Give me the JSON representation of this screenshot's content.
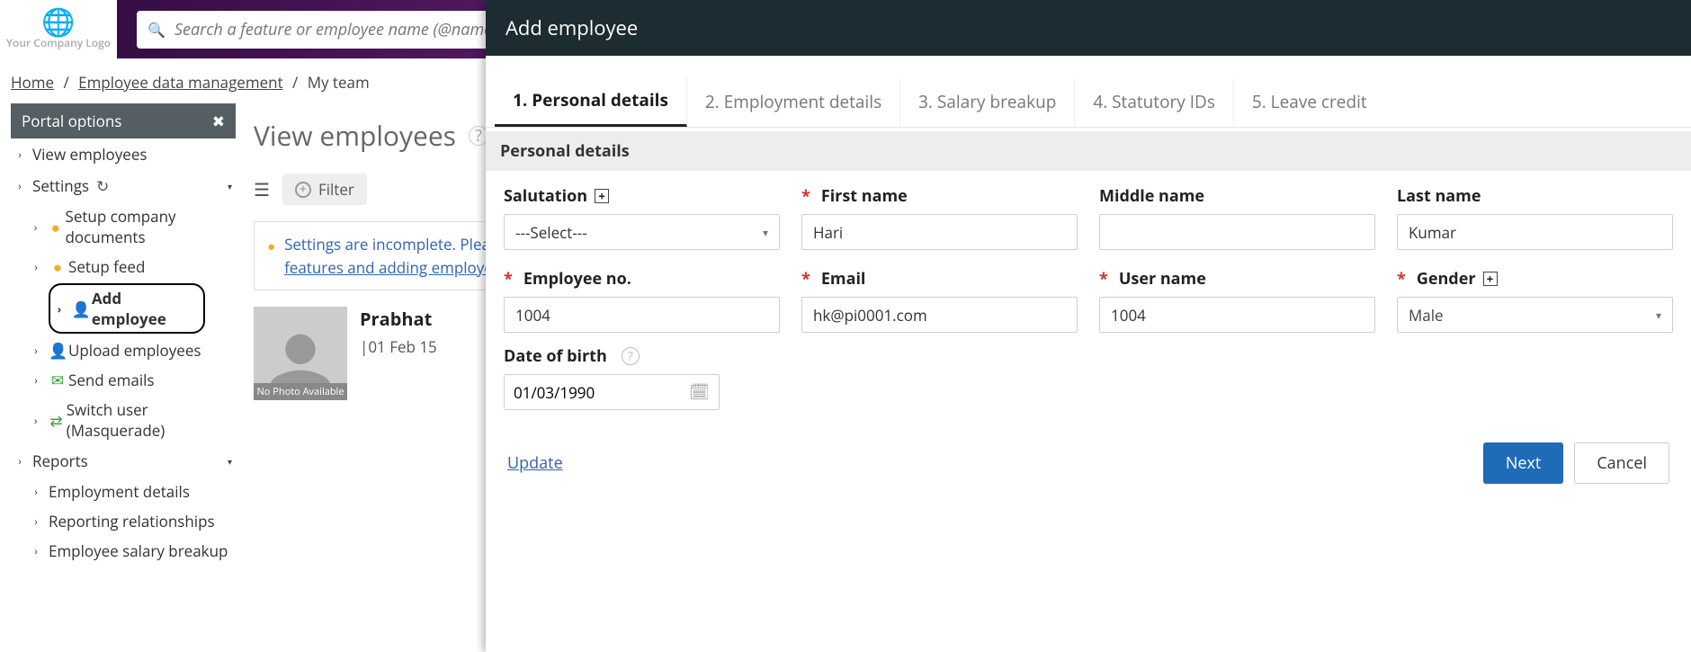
{
  "header": {
    "logo_text": "Your Company Logo",
    "search_placeholder": "Search a feature or employee name (@name)"
  },
  "breadcrumbs": {
    "items": [
      "Home",
      "Employee data management",
      "My team"
    ]
  },
  "portal": {
    "title": "Portal options",
    "view_employees": "View employees",
    "settings": "Settings",
    "setup_company_documents": "Setup company documents",
    "setup_feed": "Setup feed",
    "add_employee": "Add employee",
    "upload_employees": "Upload employees",
    "send_emails": "Send emails",
    "switch_user": "Switch user (Masquerade)",
    "reports": "Reports",
    "employment_details": "Employment details",
    "reporting_relationships": "Reporting relationships",
    "employee_salary_breakup": "Employee salary breakup"
  },
  "main": {
    "title": "View employees",
    "filter_label": "Filter",
    "alert_pre": "Settings are incomplete. Please ",
    "alert_link": "setup features and adding employee licenses.",
    "employee": {
      "name": "Prabhat",
      "joined": "|01 Feb 15",
      "no_photo": "No Photo Available"
    }
  },
  "modal": {
    "title": "Add employee",
    "tabs": [
      "1. Personal details",
      "2. Employment details",
      "3. Salary breakup",
      "4. Statutory IDs",
      "5. Leave credit"
    ],
    "section_title": "Personal details",
    "labels": {
      "salutation": "Salutation",
      "first_name": "First name",
      "middle_name": "Middle name",
      "last_name": "Last name",
      "employee_no": "Employee no.",
      "email": "Email",
      "user_name": "User name",
      "gender": "Gender",
      "dob": "Date of birth"
    },
    "values": {
      "salutation": "---Select---",
      "first_name": "Hari",
      "middle_name": "",
      "last_name": "Kumar",
      "employee_no": "1004",
      "email": "hk@pi0001.com",
      "user_name": "1004",
      "gender": "Male",
      "dob": "01/03/1990"
    },
    "footer": {
      "update": "Update",
      "next": "Next",
      "cancel": "Cancel"
    }
  }
}
